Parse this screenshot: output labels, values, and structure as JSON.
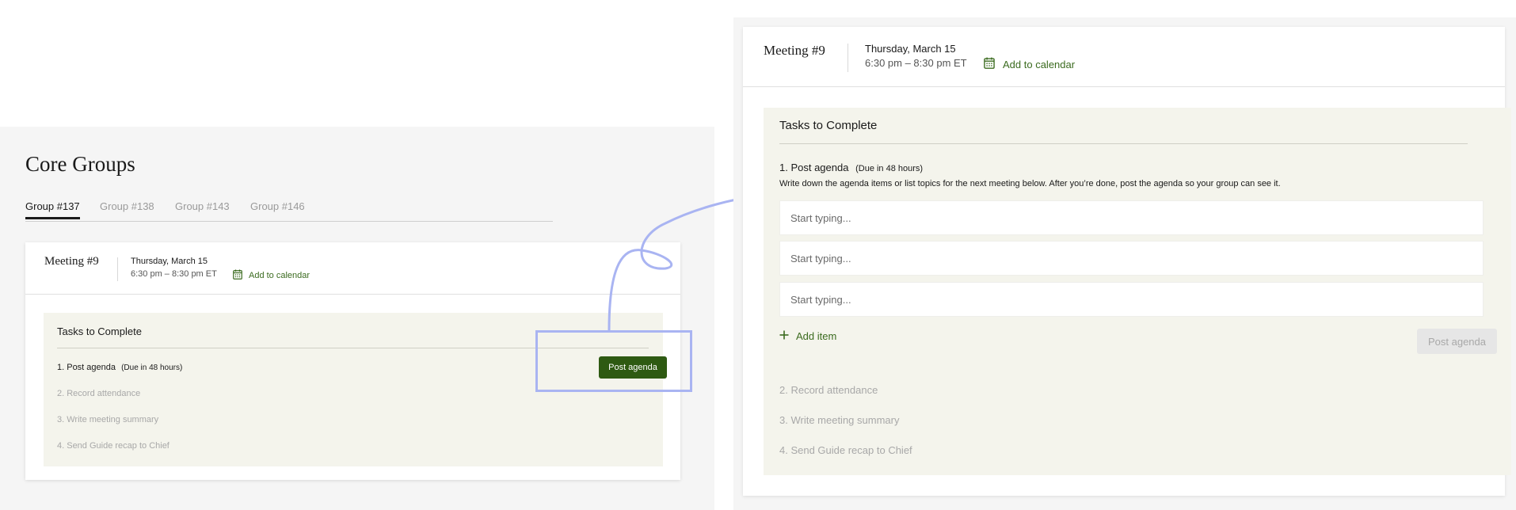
{
  "left": {
    "page_title": "Core Groups",
    "tabs": [
      {
        "label": "Group #137",
        "active": true
      },
      {
        "label": "Group #138",
        "active": false
      },
      {
        "label": "Group #143",
        "active": false
      },
      {
        "label": "Group #146",
        "active": false
      }
    ],
    "meeting": {
      "title": "Meeting #9",
      "date": "Thursday, March 15",
      "time": "6:30 pm – 8:30 pm ET",
      "calendar_label": "Add to calendar"
    },
    "tasks": {
      "heading": "Tasks to Complete",
      "items": [
        {
          "label": "1. Post agenda",
          "due": "(Due in 48 hours)",
          "active": true
        },
        {
          "label": "2. Record attendance",
          "active": false
        },
        {
          "label": "3. Write meeting summary",
          "active": false
        },
        {
          "label": "4. Send Guide recap to Chief",
          "active": false
        }
      ],
      "post_button_label": "Post agenda"
    }
  },
  "right": {
    "meeting": {
      "title": "Meeting #9",
      "date": "Thursday, March 15",
      "time": "6:30 pm – 8:30 pm ET",
      "calendar_label": "Add to calendar"
    },
    "tasks": {
      "heading": "Tasks to Complete",
      "active_task": {
        "label": "1. Post agenda",
        "due": "(Due in 48 hours)",
        "description": "Write down the agenda items or list topics for the next meeting below. After you’re done, post the agenda so your group can see it."
      },
      "inputs": [
        {
          "placeholder": "Start typing..."
        },
        {
          "placeholder": "Start typing..."
        },
        {
          "placeholder": "Start typing..."
        }
      ],
      "add_item_label": "Add item",
      "post_button_label": "Post agenda",
      "remaining_items": [
        "2. Record attendance",
        "3. Write meeting summary",
        "4. Send Guide recap to Chief"
      ]
    }
  },
  "colors": {
    "accent_green": "#3b6b1f",
    "button_green": "#2e5a12",
    "tasks_background": "#f4f4ec",
    "highlight_blue": "#a9b4f2"
  },
  "icons": {
    "calendar": "calendar-icon",
    "add": "plus-icon",
    "connector": "arrow-connector"
  }
}
